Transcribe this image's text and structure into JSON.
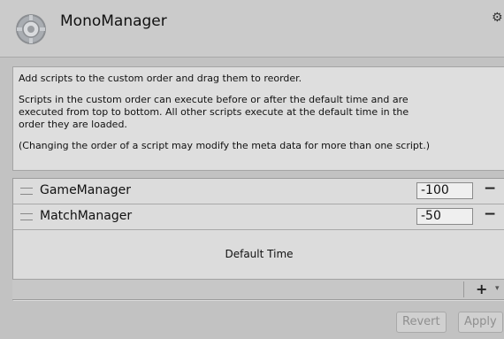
{
  "header": {
    "title": "MonoManager",
    "icon": "script-gear-icon",
    "settings_icon": "gear-icon"
  },
  "info": {
    "line1": "Add scripts to the custom order and drag them to reorder.",
    "line2": "Scripts in the custom order can execute before or after the default time and are\nexecuted from top to bottom. All other scripts execute at the default time in the\norder they are loaded.",
    "line3": "(Changing the order of a script may modify the meta data for more than one script.)"
  },
  "scripts": [
    {
      "name": "GameManager",
      "order": "-100",
      "remove": "−"
    },
    {
      "name": "MatchManager",
      "order": "-50",
      "remove": "−"
    }
  ],
  "default_time_label": "Default Time",
  "toolbar": {
    "add": "+",
    "add_dropdown": "▾"
  },
  "buttons": {
    "revert": "Revert",
    "apply": "Apply"
  }
}
